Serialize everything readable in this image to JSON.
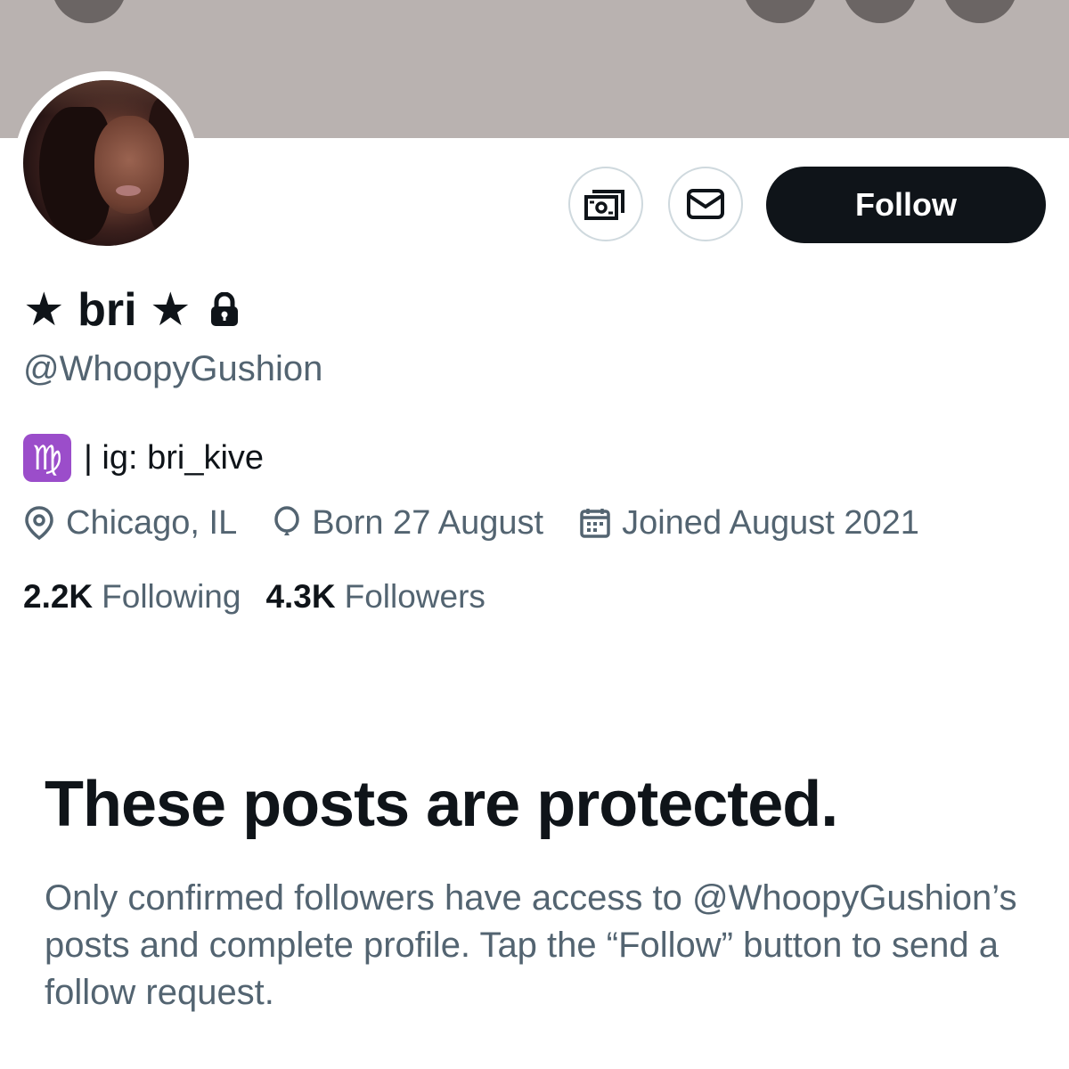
{
  "header": {
    "back_icon": "arrow-left-icon",
    "right_icons": [
      "search-icon",
      "share-icon",
      "more-icon"
    ],
    "banner_color": "#b9b2b0"
  },
  "profile": {
    "display_name": "★ bri ★",
    "protected_icon": "lock-icon",
    "handle": "@WhoopyGushion",
    "bio_emoji": "♍",
    "bio_text": "| ig: bri_kive",
    "location": "Chicago, IL",
    "birthday": "Born 27 August",
    "joined": "Joined August 2021",
    "following_count": "2.2K",
    "following_label": "Following",
    "followers_count": "4.3K",
    "followers_label": "Followers"
  },
  "actions": {
    "tip_icon": "money-icon",
    "message_icon": "envelope-icon",
    "follow_label": "Follow"
  },
  "protected_notice": {
    "title": "These posts are protected.",
    "body": "Only confirmed followers have access to @WhoopyGushion’s posts and complete profile. Tap the “Follow” button to send a follow request."
  },
  "colors": {
    "text_primary": "#0f1419",
    "text_secondary": "#536471",
    "follow_button_bg": "#0f1419",
    "zodiac_bg": "#9b4dca"
  }
}
